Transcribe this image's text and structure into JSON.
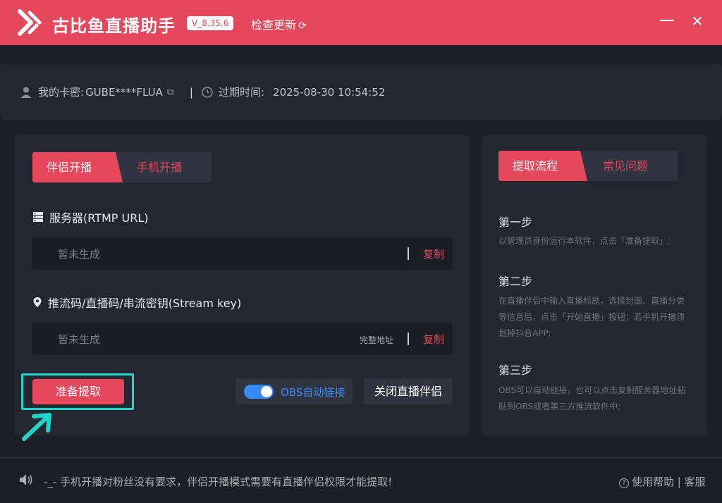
{
  "app": {
    "title": "古比鱼直播助手",
    "version": "V_8.35.6",
    "check_update": "检查更新"
  },
  "account": {
    "card_label": "我的卡密:",
    "card_value": "GUBE****FLUA",
    "separator": "|",
    "expire_label": "过期时间:",
    "expire_value": "2025-08-30 10:54:52"
  },
  "left_panel": {
    "tabs": [
      "伴侣开播",
      "手机开播"
    ],
    "active_tab": "伴侣开播",
    "server": {
      "label": "服务器(RTMP URL)",
      "placeholder": "暂未生成",
      "copy_label": "复制"
    },
    "stream_key": {
      "label": "推流码/直播码/串流密钥(Stream key)",
      "placeholder": "暂未生成",
      "full_address_label": "完整地址",
      "copy_label": "复制"
    },
    "prepare_button": "准备提取",
    "obs_toggle": {
      "label": "OBS自动链接",
      "enabled": true
    },
    "close_companion_button": "关闭直播伴侣"
  },
  "right_panel": {
    "tabs": [
      "提取流程",
      "常见问题"
    ],
    "active_tab": "提取流程",
    "steps": [
      {
        "title": "第一步",
        "desc": "以管理员身份运行本软件，点击「准备提取」;"
      },
      {
        "title": "第二步",
        "desc": "在直播伴侣中输入直播标题，选择封面、直播分类等信息后，点击「开始直播」按钮；若手机开播须划掉抖音APP;"
      },
      {
        "title": "第三步",
        "desc": "OBS可以自动链接，也可以点击复制服务器地址粘贴到OBS或者第三方推流软件中;"
      }
    ]
  },
  "footer": {
    "notice": "-_- 手机开播对粉丝没有要求，伴侣开播模式需要有直播伴侣权限才能提取!",
    "help_label": "使用帮助",
    "separator": "|",
    "service_label": "客服"
  },
  "colors": {
    "brand": "#e5475c",
    "background": "#1b1f26",
    "panel": "#23272f",
    "toggle_on": "#3a8bf5",
    "highlight": "#1fd6cc"
  }
}
